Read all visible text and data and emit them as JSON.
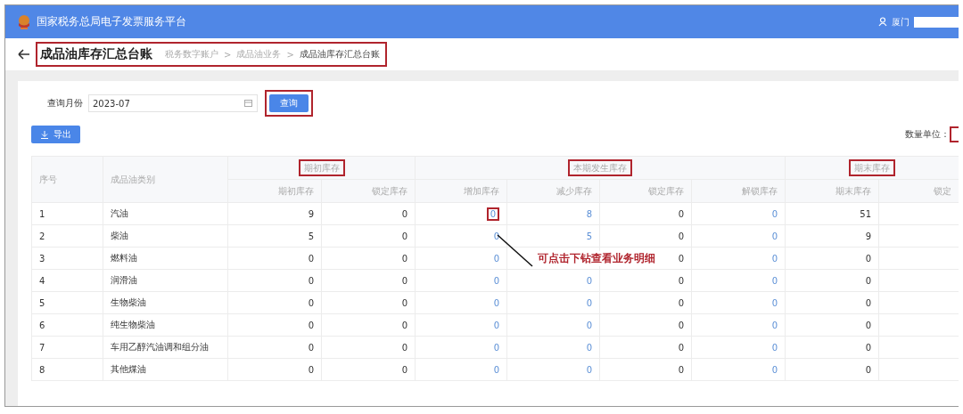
{
  "header": {
    "title": "国家税务总局电子发票服务平台",
    "user": "厦门"
  },
  "page": {
    "title": "成品油库存汇总台账",
    "breadcrumb": [
      "税务数字账户",
      "成品油业务",
      "成品油库存汇总台账"
    ],
    "separator": ">",
    "highlighted": true
  },
  "query": {
    "label": "查询月份",
    "value": "2023-07",
    "button": {
      "label": "查询",
      "highlighted": true
    }
  },
  "export_button": {
    "label": "导出"
  },
  "unit": {
    "label": "数量单位：",
    "highlighted": true
  },
  "table": {
    "columns": [
      {
        "label": "序号"
      },
      {
        "label": "成品油类别"
      }
    ],
    "groups": [
      {
        "label": "期初库存",
        "highlighted": true,
        "columns": [
          {
            "label": "期初库存"
          },
          {
            "label": "锁定库存"
          }
        ]
      },
      {
        "label": "本期发生库存",
        "highlighted": true,
        "columns": [
          {
            "label": "增加库存",
            "clickable": true
          },
          {
            "label": "减少库存",
            "clickable": true
          },
          {
            "label": "锁定库存"
          },
          {
            "label": "解锁库存",
            "clickable": true
          }
        ]
      },
      {
        "label": "期末库存",
        "highlighted": true,
        "columns": [
          {
            "label": "期末库存"
          },
          {
            "label": "锁定"
          }
        ]
      }
    ],
    "rows": [
      {
        "cells": [
          "1",
          "汽油",
          "9",
          "0",
          {
            "text": "0",
            "highlighted": true
          },
          "8",
          "0",
          "0",
          "51"
        ]
      },
      {
        "cells": [
          "2",
          "柴油",
          "5",
          "0",
          "0",
          "5",
          "0",
          "0",
          "9"
        ]
      },
      {
        "cells": [
          "3",
          "燃料油",
          "0",
          "0",
          "0",
          null,
          "0",
          "0",
          "0"
        ]
      },
      {
        "cells": [
          "4",
          "润滑油",
          "0",
          "0",
          "0",
          "0",
          "0",
          "0",
          "0"
        ]
      },
      {
        "cells": [
          "5",
          "生物柴油",
          "0",
          "0",
          "0",
          "0",
          "0",
          "0",
          "0"
        ]
      },
      {
        "cells": [
          "6",
          "纯生物柴油",
          "0",
          "0",
          "0",
          "0",
          "0",
          "0",
          "0"
        ]
      },
      {
        "cells": [
          "7",
          "车用乙醇汽油调和组分油",
          "0",
          "0",
          "0",
          "0",
          "0",
          "0",
          "0"
        ]
      },
      {
        "cells": [
          "8",
          "其他煤油",
          "0",
          "0",
          "0",
          "0",
          "0",
          "0",
          "0"
        ]
      }
    ]
  },
  "annotation": {
    "text": "可点击下钻查看业务明细"
  }
}
